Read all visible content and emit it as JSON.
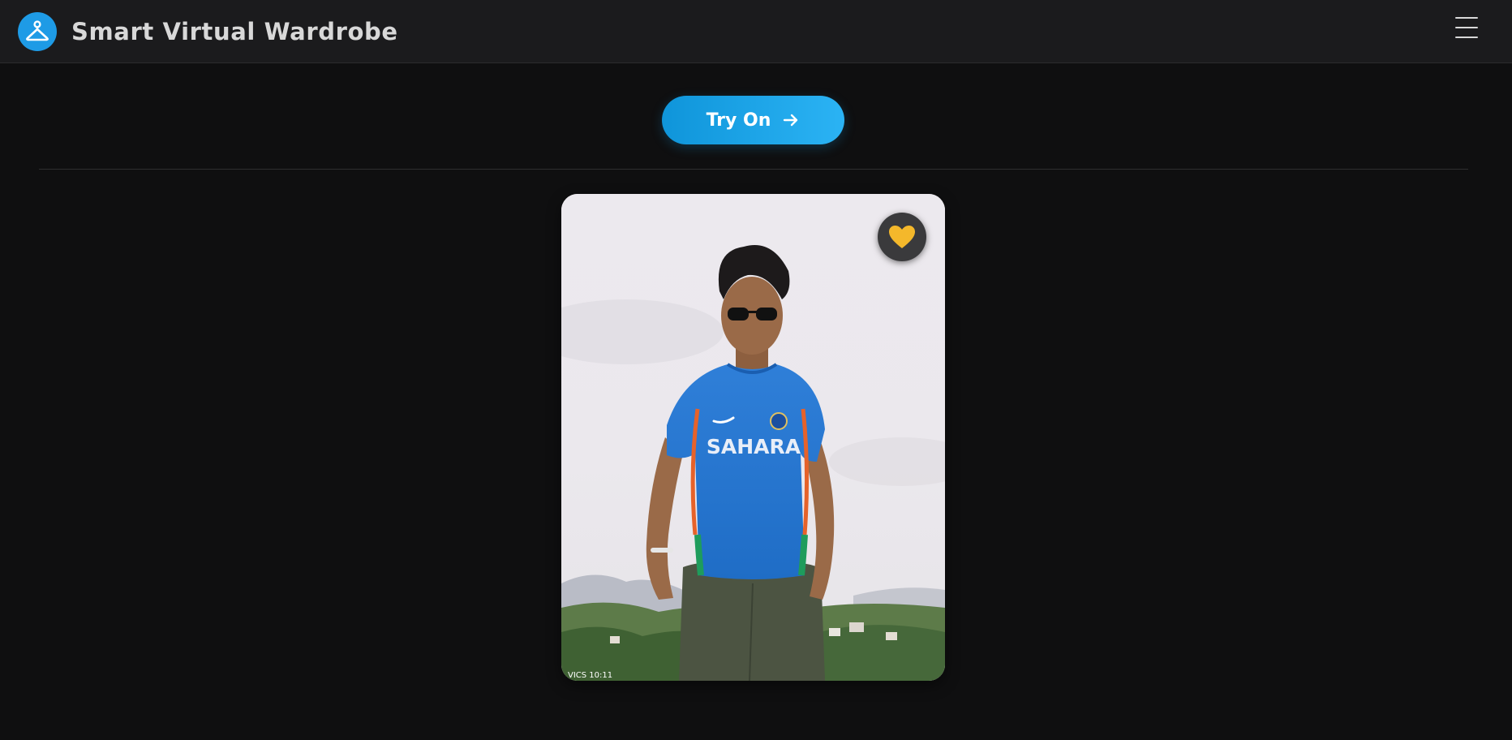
{
  "header": {
    "app_title": "Smart Virtual Wardrobe",
    "logo_icon": "hanger-icon",
    "menu_icon": "hamburger-menu-icon"
  },
  "actions": {
    "try_on_label": "Try On",
    "try_on_icon": "arrow-right-icon"
  },
  "card": {
    "photo_icon": "person-photo",
    "jersey_text": "SAHARA",
    "corner_text": "VICS 10:11",
    "favorite_icon": "heart-icon"
  },
  "colors": {
    "accent": "#1e9be6",
    "heart": "#f4b82b",
    "background": "#0f0f10",
    "topbar": "#1b1b1d"
  }
}
